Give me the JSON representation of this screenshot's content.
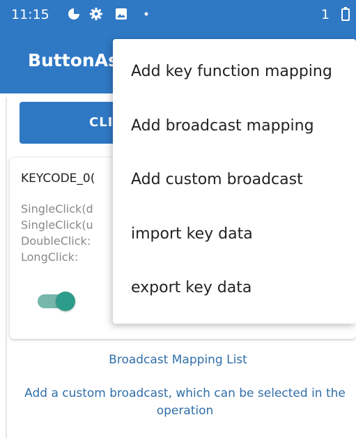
{
  "status_bar": {
    "time": "11:15",
    "icons": [
      "data-saver-icon",
      "gear-icon",
      "image-icon",
      "dot-icon"
    ],
    "right_text": "1"
  },
  "app_bar": {
    "title": "ButtonAs"
  },
  "main": {
    "click_button_label": "CLI",
    "key_card": {
      "code": "KEYCODE_0(",
      "lines": [
        "SingleClick(d",
        "SingleClick(u",
        "DoubleClick:",
        "LongClick:"
      ],
      "toggle_on": true
    },
    "broadcast_title": "Broadcast Mapping List",
    "broadcast_desc": "Add a custom broadcast, which can be selected in the operation"
  },
  "menu": {
    "items": [
      "Add key function mapping",
      "Add broadcast mapping",
      "Add custom broadcast",
      "import key data",
      "export key data"
    ]
  },
  "colors": {
    "primary": "#2f78c4",
    "link": "#2f6ea8",
    "toggle_thumb": "#2e9c8a",
    "toggle_track": "#76b7ac"
  }
}
